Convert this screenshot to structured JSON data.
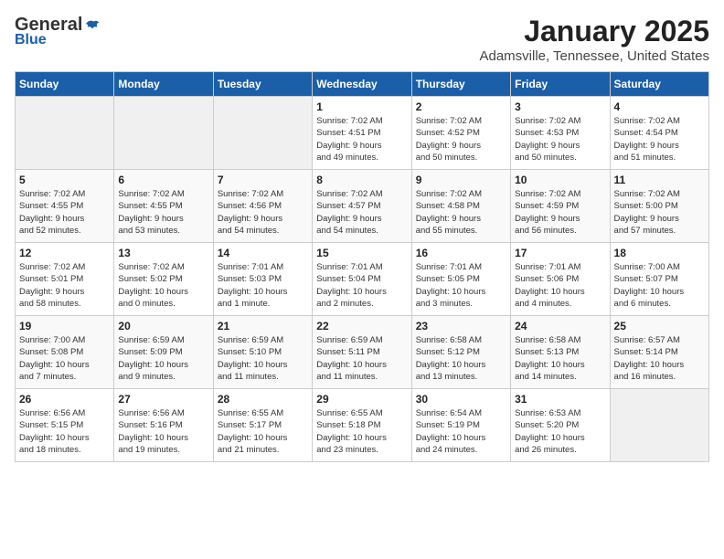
{
  "logo": {
    "general": "General",
    "blue": "Blue"
  },
  "header": {
    "title": "January 2025",
    "subtitle": "Adamsville, Tennessee, United States"
  },
  "weekdays": [
    "Sunday",
    "Monday",
    "Tuesday",
    "Wednesday",
    "Thursday",
    "Friday",
    "Saturday"
  ],
  "weeks": [
    [
      {
        "day": "",
        "info": ""
      },
      {
        "day": "",
        "info": ""
      },
      {
        "day": "",
        "info": ""
      },
      {
        "day": "1",
        "info": "Sunrise: 7:02 AM\nSunset: 4:51 PM\nDaylight: 9 hours\nand 49 minutes."
      },
      {
        "day": "2",
        "info": "Sunrise: 7:02 AM\nSunset: 4:52 PM\nDaylight: 9 hours\nand 50 minutes."
      },
      {
        "day": "3",
        "info": "Sunrise: 7:02 AM\nSunset: 4:53 PM\nDaylight: 9 hours\nand 50 minutes."
      },
      {
        "day": "4",
        "info": "Sunrise: 7:02 AM\nSunset: 4:54 PM\nDaylight: 9 hours\nand 51 minutes."
      }
    ],
    [
      {
        "day": "5",
        "info": "Sunrise: 7:02 AM\nSunset: 4:55 PM\nDaylight: 9 hours\nand 52 minutes."
      },
      {
        "day": "6",
        "info": "Sunrise: 7:02 AM\nSunset: 4:55 PM\nDaylight: 9 hours\nand 53 minutes."
      },
      {
        "day": "7",
        "info": "Sunrise: 7:02 AM\nSunset: 4:56 PM\nDaylight: 9 hours\nand 54 minutes."
      },
      {
        "day": "8",
        "info": "Sunrise: 7:02 AM\nSunset: 4:57 PM\nDaylight: 9 hours\nand 54 minutes."
      },
      {
        "day": "9",
        "info": "Sunrise: 7:02 AM\nSunset: 4:58 PM\nDaylight: 9 hours\nand 55 minutes."
      },
      {
        "day": "10",
        "info": "Sunrise: 7:02 AM\nSunset: 4:59 PM\nDaylight: 9 hours\nand 56 minutes."
      },
      {
        "day": "11",
        "info": "Sunrise: 7:02 AM\nSunset: 5:00 PM\nDaylight: 9 hours\nand 57 minutes."
      }
    ],
    [
      {
        "day": "12",
        "info": "Sunrise: 7:02 AM\nSunset: 5:01 PM\nDaylight: 9 hours\nand 58 minutes."
      },
      {
        "day": "13",
        "info": "Sunrise: 7:02 AM\nSunset: 5:02 PM\nDaylight: 10 hours\nand 0 minutes."
      },
      {
        "day": "14",
        "info": "Sunrise: 7:01 AM\nSunset: 5:03 PM\nDaylight: 10 hours\nand 1 minute."
      },
      {
        "day": "15",
        "info": "Sunrise: 7:01 AM\nSunset: 5:04 PM\nDaylight: 10 hours\nand 2 minutes."
      },
      {
        "day": "16",
        "info": "Sunrise: 7:01 AM\nSunset: 5:05 PM\nDaylight: 10 hours\nand 3 minutes."
      },
      {
        "day": "17",
        "info": "Sunrise: 7:01 AM\nSunset: 5:06 PM\nDaylight: 10 hours\nand 4 minutes."
      },
      {
        "day": "18",
        "info": "Sunrise: 7:00 AM\nSunset: 5:07 PM\nDaylight: 10 hours\nand 6 minutes."
      }
    ],
    [
      {
        "day": "19",
        "info": "Sunrise: 7:00 AM\nSunset: 5:08 PM\nDaylight: 10 hours\nand 7 minutes."
      },
      {
        "day": "20",
        "info": "Sunrise: 6:59 AM\nSunset: 5:09 PM\nDaylight: 10 hours\nand 9 minutes."
      },
      {
        "day": "21",
        "info": "Sunrise: 6:59 AM\nSunset: 5:10 PM\nDaylight: 10 hours\nand 11 minutes."
      },
      {
        "day": "22",
        "info": "Sunrise: 6:59 AM\nSunset: 5:11 PM\nDaylight: 10 hours\nand 11 minutes."
      },
      {
        "day": "23",
        "info": "Sunrise: 6:58 AM\nSunset: 5:12 PM\nDaylight: 10 hours\nand 13 minutes."
      },
      {
        "day": "24",
        "info": "Sunrise: 6:58 AM\nSunset: 5:13 PM\nDaylight: 10 hours\nand 14 minutes."
      },
      {
        "day": "25",
        "info": "Sunrise: 6:57 AM\nSunset: 5:14 PM\nDaylight: 10 hours\nand 16 minutes."
      }
    ],
    [
      {
        "day": "26",
        "info": "Sunrise: 6:56 AM\nSunset: 5:15 PM\nDaylight: 10 hours\nand 18 minutes."
      },
      {
        "day": "27",
        "info": "Sunrise: 6:56 AM\nSunset: 5:16 PM\nDaylight: 10 hours\nand 19 minutes."
      },
      {
        "day": "28",
        "info": "Sunrise: 6:55 AM\nSunset: 5:17 PM\nDaylight: 10 hours\nand 21 minutes."
      },
      {
        "day": "29",
        "info": "Sunrise: 6:55 AM\nSunset: 5:18 PM\nDaylight: 10 hours\nand 23 minutes."
      },
      {
        "day": "30",
        "info": "Sunrise: 6:54 AM\nSunset: 5:19 PM\nDaylight: 10 hours\nand 24 minutes."
      },
      {
        "day": "31",
        "info": "Sunrise: 6:53 AM\nSunset: 5:20 PM\nDaylight: 10 hours\nand 26 minutes."
      },
      {
        "day": "",
        "info": ""
      }
    ]
  ]
}
